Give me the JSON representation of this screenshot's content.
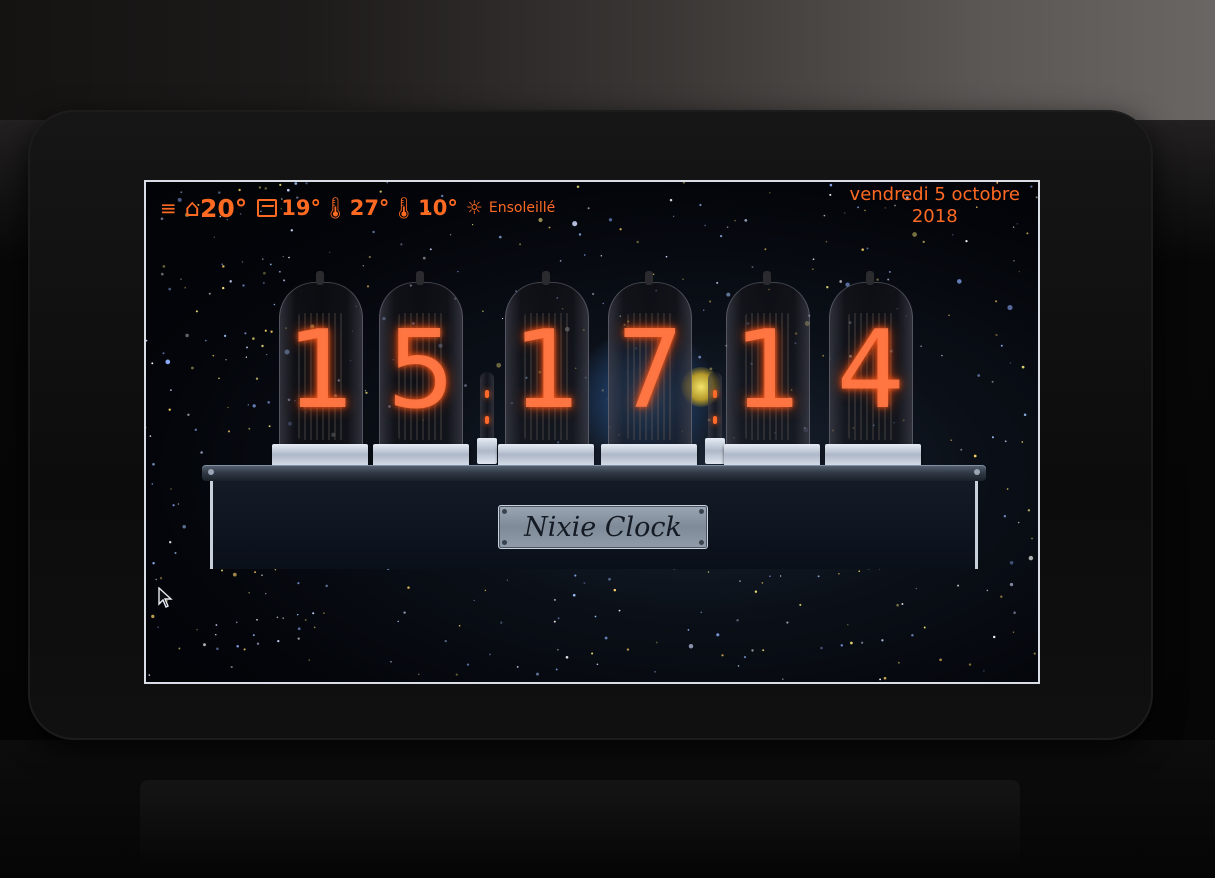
{
  "status_bar": {
    "menu_icon": "menu-icon",
    "home_icon": "home-icon",
    "indoor_temp": "20°",
    "forecast_icon": "picture-icon",
    "current_temp": "19°",
    "max_icon": "thermometer-high-icon",
    "max_temp": "27°",
    "min_icon": "thermometer-low-icon",
    "min_temp": "10°",
    "weather_icon": "sun-icon",
    "condition": "Ensoleillé"
  },
  "date": {
    "line1": "vendredi 5 octobre",
    "line2": "2018"
  },
  "clock": {
    "digits": [
      "1",
      "5",
      "1",
      "7",
      "1",
      "4"
    ],
    "label": "Nixie Clock"
  },
  "colors": {
    "accent": "#ff6a23",
    "screen_border": "#d9dde6"
  }
}
